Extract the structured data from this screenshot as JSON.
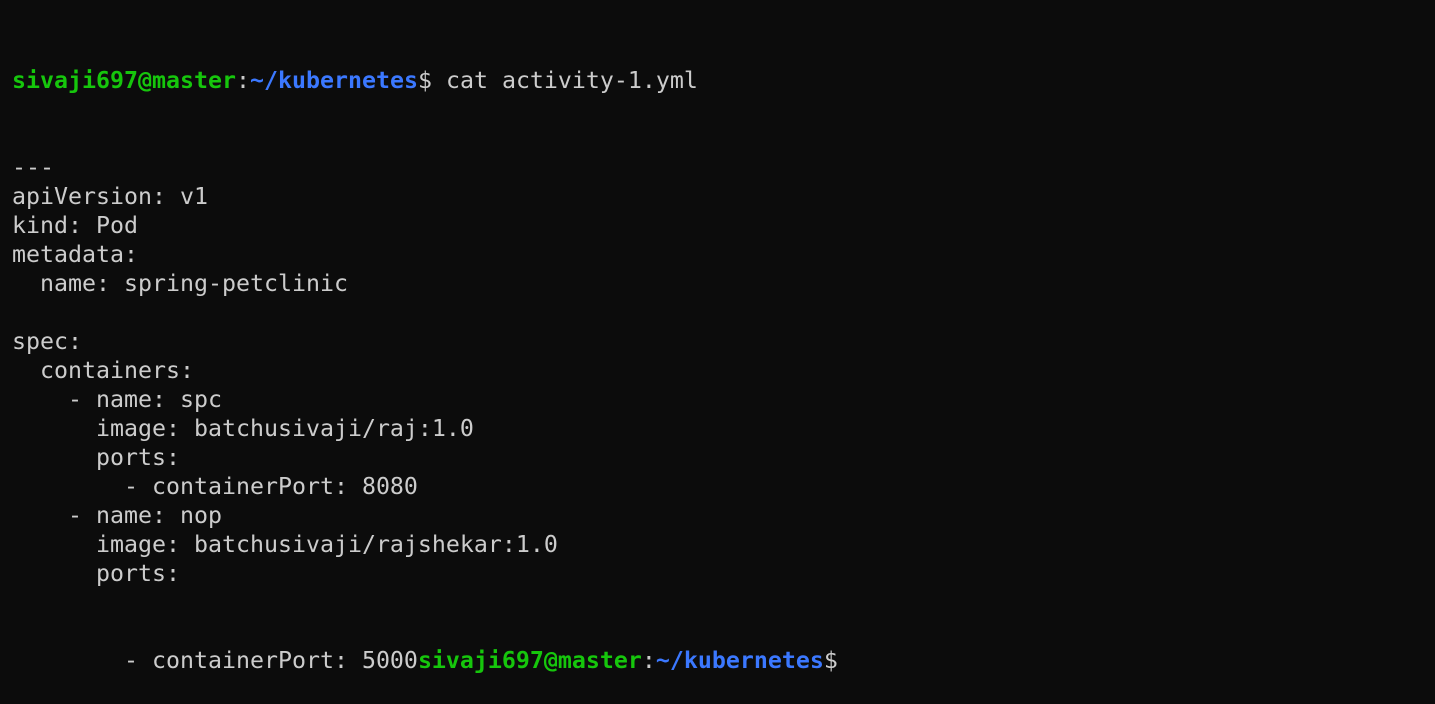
{
  "terminal": {
    "colors": {
      "background": "#0c0c0c",
      "text": "#cccccc",
      "user": "#16c60c",
      "path": "#3b78ff"
    },
    "prompt": {
      "user_host": "sivaji697@master",
      "sep": ":",
      "path": "~/kubernetes",
      "symbol": "$"
    },
    "command": " cat activity-1.yml",
    "output_lines": [
      "---",
      "apiVersion: v1",
      "kind: Pod",
      "metadata:",
      "  name: spring-petclinic",
      "",
      "spec:",
      "  containers:",
      "    - name: spc",
      "      image: batchusivaji/raj:1.0",
      "      ports:",
      "        - containerPort: 8080",
      "    - name: nop",
      "      image: batchusivaji/rajshekar:1.0",
      "      ports:"
    ],
    "last_output": "        - containerPort: 5000"
  }
}
